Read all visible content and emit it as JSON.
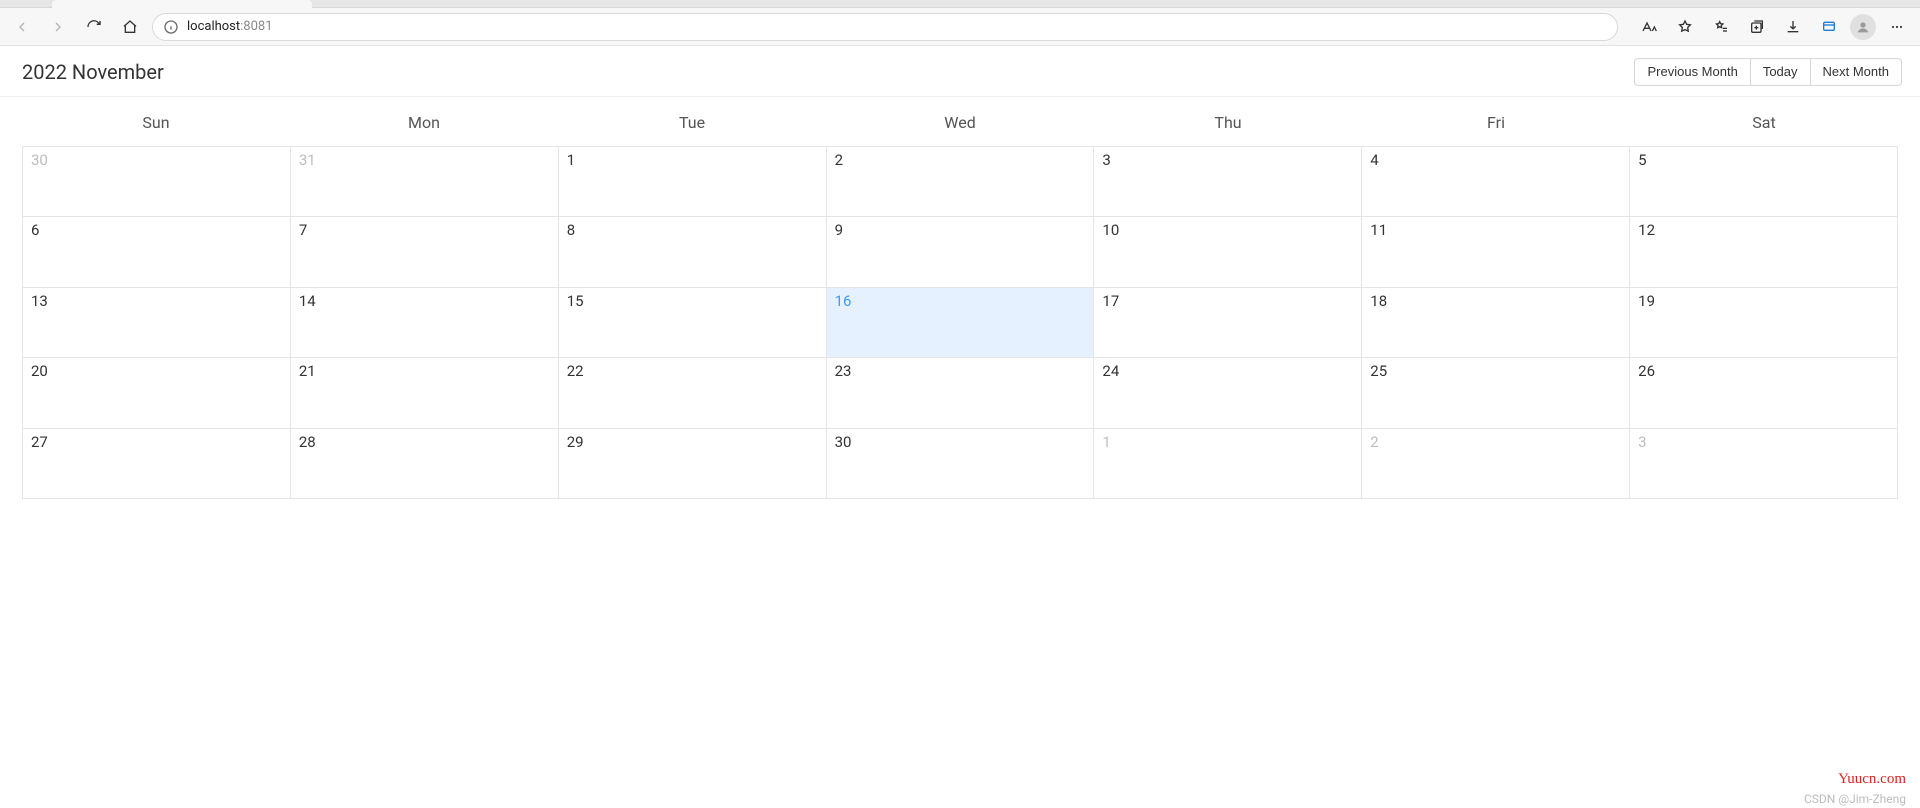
{
  "browser": {
    "url_host": "localhost",
    "url_port": ":8081"
  },
  "calendar": {
    "title": "2022 November",
    "buttons": {
      "prev": "Previous Month",
      "today": "Today",
      "next": "Next Month"
    },
    "dow": [
      "Sun",
      "Mon",
      "Tue",
      "Wed",
      "Thu",
      "Fri",
      "Sat"
    ],
    "cells": [
      {
        "d": "30",
        "other": true
      },
      {
        "d": "31",
        "other": true
      },
      {
        "d": "1"
      },
      {
        "d": "2"
      },
      {
        "d": "3"
      },
      {
        "d": "4"
      },
      {
        "d": "5"
      },
      {
        "d": "6"
      },
      {
        "d": "7"
      },
      {
        "d": "8"
      },
      {
        "d": "9"
      },
      {
        "d": "10"
      },
      {
        "d": "11"
      },
      {
        "d": "12"
      },
      {
        "d": "13"
      },
      {
        "d": "14"
      },
      {
        "d": "15"
      },
      {
        "d": "16",
        "today": true
      },
      {
        "d": "17"
      },
      {
        "d": "18"
      },
      {
        "d": "19"
      },
      {
        "d": "20"
      },
      {
        "d": "21"
      },
      {
        "d": "22"
      },
      {
        "d": "23"
      },
      {
        "d": "24"
      },
      {
        "d": "25"
      },
      {
        "d": "26"
      },
      {
        "d": "27"
      },
      {
        "d": "28"
      },
      {
        "d": "29"
      },
      {
        "d": "30"
      },
      {
        "d": "1",
        "other": true
      },
      {
        "d": "2",
        "other": true
      },
      {
        "d": "3",
        "other": true
      }
    ]
  },
  "watermark": {
    "site": "Yuucn.com",
    "author": "CSDN @Jim-Zheng"
  }
}
